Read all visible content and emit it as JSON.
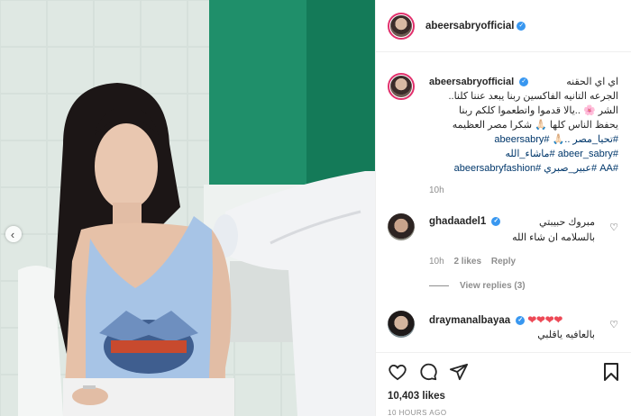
{
  "header": {
    "username": "abeersabryofficial"
  },
  "caption": {
    "username": "abeersabryofficial",
    "lines": [
      "اي اي الحقنه",
      "الجرعه التانيه الفاكسين ربنا يبعد عننا كلنا..",
      "الشر 🌸 ..يالا قدموا واتطعموا كلكم ربنا",
      "يحفظ الناس كلها 🙏🏻 شكرا مصر العظيمه"
    ],
    "hashtags_line1": "#تحيا_مصر ..🙏🏻 #abeersabry",
    "hashtags_line2": "#abeer_sabry #ماشاء_الله",
    "hashtags_line3": "#AA #عبير_صبري #abeersabryfashion",
    "time": "10h"
  },
  "comments": [
    {
      "username": "ghadaadel1",
      "text_line1": "مبروك حبيبتي",
      "text_line2": "بالسلامه ان شاء الله",
      "time": "10h",
      "likes": "2 likes",
      "reply": "Reply",
      "view_replies": "View replies (3)"
    },
    {
      "username": "draymanalbayaa",
      "hearts": "❤❤❤❤",
      "text_line2": "بالعافيه ياقلبي"
    }
  ],
  "post": {
    "likes": "10,403 likes",
    "posted": "10 HOURS AGO"
  },
  "icons": {
    "like": "heart-icon",
    "comment": "comment-icon",
    "share": "share-icon",
    "save": "bookmark-icon",
    "prev": "chevron-left-icon"
  }
}
